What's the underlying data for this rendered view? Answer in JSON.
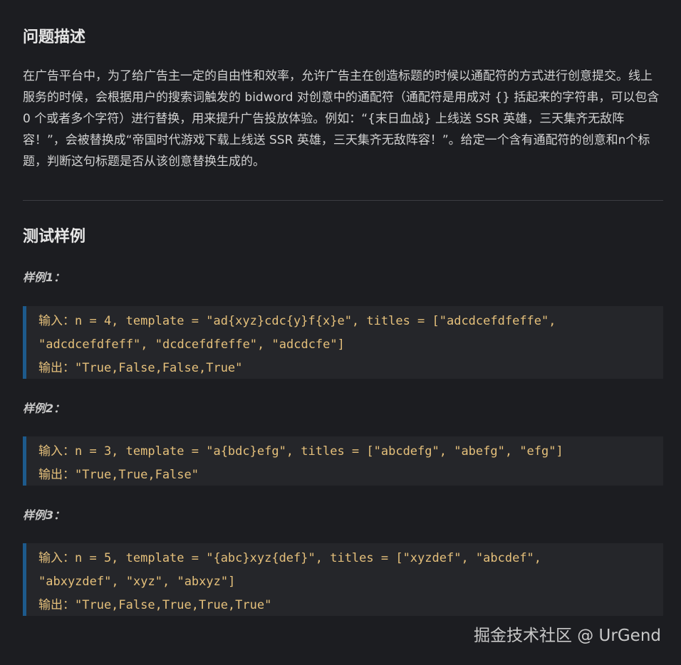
{
  "problem": {
    "title": "问题描述",
    "description": "在广告平台中，为了给广告主一定的自由性和效率，允许广告主在创造标题的时候以通配符的方式进行创意提交。线上服务的时候，会根据用户的搜索词触发的 bidword 对创意中的通配符（通配符是用成对 {} 括起来的字符串，可以包含 0 个或者多个字符）进行替换，用来提升广告投放体验。例如：“{末日血战} 上线送 SSR 英雄，三天集齐无敌阵容！”，会被替换成“帝国时代游戏下载上线送 SSR 英雄，三天集齐无敌阵容！”。给定一个含有通配符的创意和n个标题，判断这句标题是否从该创意替换生成的。"
  },
  "tests": {
    "title": "测试样例",
    "examples": [
      {
        "label": "样例1：",
        "input_key": "输入：",
        "input_line1": "n = 4, template = \"ad{xyz}cdc{y}f{x}e\", titles = [\"adcdcefdfeffe\",",
        "input_line2": "\"adcdcefdfeff\", \"dcdcefdfeffe\", \"adcdcfe\"]",
        "output_key": "输出：",
        "output": "\"True,False,False,True\""
      },
      {
        "label": "样例2：",
        "input_key": "输入：",
        "input_line1": "n = 3, template = \"a{bdc}efg\", titles = [\"abcdefg\", \"abefg\", \"efg\"]",
        "output_key": "输出：",
        "output": "\"True,True,False\""
      },
      {
        "label": "样例3：",
        "input_key": "输入：",
        "input_line1": "n = 5, template = \"{abc}xyz{def}\", titles = [\"xyzdef\", \"abcdef\",",
        "input_line2": "\"abxyzdef\", \"xyz\", \"abxyz\"]",
        "output_key": "输出：",
        "output": "\"True,False,True,True,True\""
      }
    ]
  },
  "watermark": "掘金技术社区 @ UrGend",
  "colors": {
    "background": "#1c1d21",
    "code_background": "#25262a",
    "code_border": "#1d5a8c",
    "code_text": "#e5c07b"
  }
}
